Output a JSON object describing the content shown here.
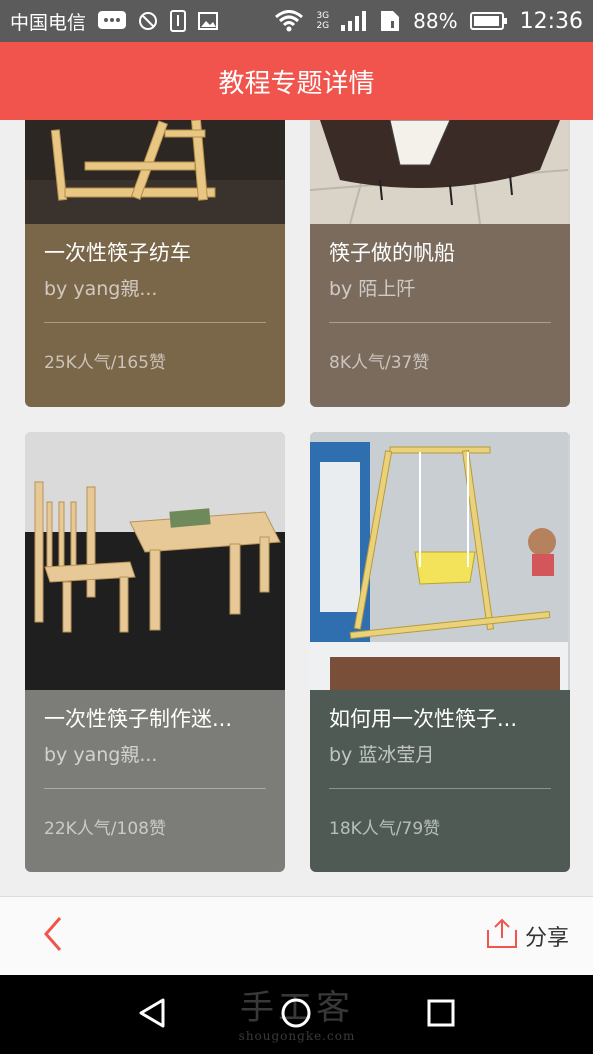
{
  "status_bar": {
    "carrier": "中国电信",
    "network_type_top": "3G",
    "network_type_bottom": "2G",
    "battery_percent": "88%",
    "time": "12:36"
  },
  "header": {
    "title": "教程专题详情"
  },
  "cards": [
    {
      "title": "一次性筷子纺车",
      "author": "by yang親...",
      "stats": "25K人气/165赞",
      "color": "#7a6649"
    },
    {
      "title": "筷子做的帆船",
      "author": "by 陌上阡",
      "stats": "8K人气/37赞",
      "color": "#7a6b5c"
    },
    {
      "title": "一次性筷子制作迷...",
      "author": "by yang親...",
      "stats": "22K人气/108赞",
      "color": "#7c7c78"
    },
    {
      "title": "如何用一次性筷子...",
      "author": "by 蓝冰莹月",
      "stats": "18K人气/79赞",
      "color": "#4f5a55"
    }
  ],
  "bottom_bar": {
    "share_label": "分享"
  },
  "watermark": {
    "text": "手工客",
    "url": "shougongke.com"
  },
  "colors": {
    "accent": "#f0544c",
    "status_bar": "#5b5b5b"
  }
}
